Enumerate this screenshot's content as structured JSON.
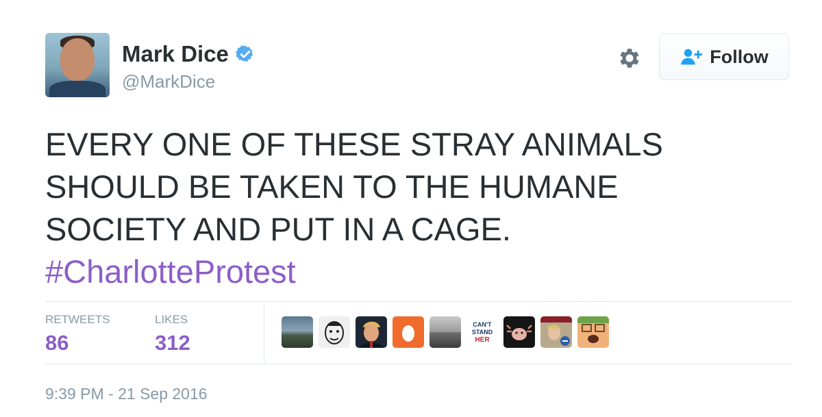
{
  "user": {
    "name": "Mark Dice",
    "handle": "@MarkDice"
  },
  "actions": {
    "follow_label": "Follow"
  },
  "tweet": {
    "lines": [
      "EVERY ONE OF THESE STRAY ANIMALS",
      "SHOULD BE TAKEN TO THE HUMANE",
      "SOCIETY AND PUT IN A CAGE."
    ],
    "hashtag": "#CharlotteProtest"
  },
  "stats": {
    "retweets_label": "RETWEETS",
    "retweets_value": "86",
    "likes_label": "LIKES",
    "likes_value": "312"
  },
  "liker_avatars": [
    {
      "name": "liker-avatar-landscape"
    },
    {
      "name": "liker-avatar-sketch"
    },
    {
      "name": "liker-avatar-portrait"
    },
    {
      "name": "liker-avatar-egg"
    },
    {
      "name": "liker-avatar-beach"
    },
    {
      "name": "liker-avatar-cant-stand-her",
      "text": [
        "CAN'T",
        "STAND",
        "HER"
      ]
    },
    {
      "name": "liker-avatar-creature"
    },
    {
      "name": "liker-avatar-person"
    },
    {
      "name": "liker-avatar-cartoon"
    }
  ],
  "timestamp": "9:39 PM - 21 Sep 2016",
  "colors": {
    "hashtag": "#8c5ec8",
    "stat_value": "#8c5ec8",
    "verified": "#55acee",
    "follow_icon": "#1da1f2",
    "secondary_text": "#8899a6"
  },
  "icons": {
    "verified": "verified-badge-icon",
    "settings": "gear-icon",
    "follow": "add-user-icon"
  }
}
